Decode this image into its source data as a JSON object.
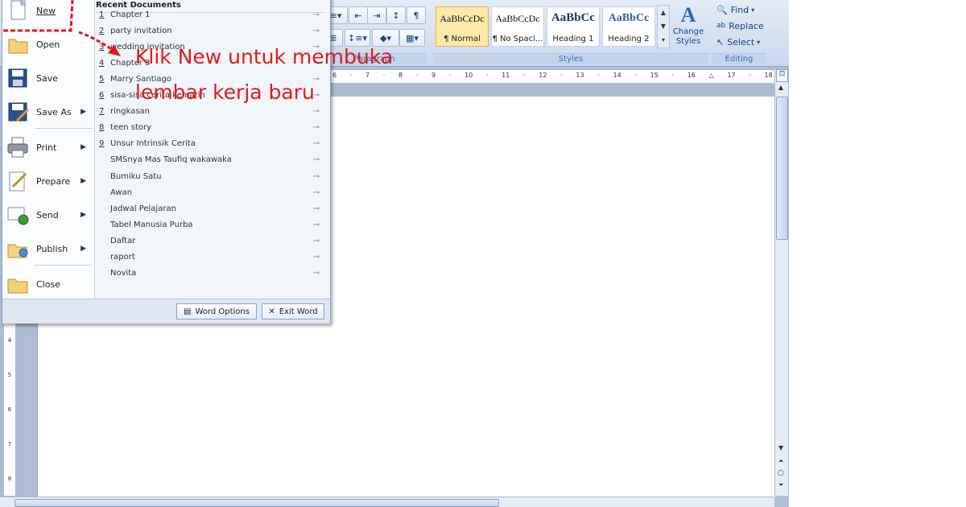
{
  "ribbon": {
    "paragraph_group": "Paragraph",
    "styles_group_label": "Styles",
    "editing_group_label": "Editing",
    "styles": [
      {
        "sample": "AaBbCcDc",
        "name": "¶ Normal"
      },
      {
        "sample": "AaBbCcDc",
        "name": "¶ No Spaci..."
      },
      {
        "sample": "AaBbCc",
        "name": "Heading 1"
      },
      {
        "sample": "AaBbCc",
        "name": "Heading 2"
      }
    ],
    "change_styles_label": "Change Styles",
    "editing": {
      "find": "Find",
      "replace": "Replace",
      "select": "Select"
    }
  },
  "ruler": {
    "marks": [
      "6",
      "7",
      "8",
      "9",
      "10",
      "11",
      "12",
      "13",
      "14",
      "15",
      "16",
      "17",
      "18"
    ],
    "vertical_marks": [
      "4",
      "5",
      "6",
      "7",
      "8"
    ]
  },
  "office_menu": {
    "items": [
      {
        "label": "New"
      },
      {
        "label": "Open"
      },
      {
        "label": "Save"
      },
      {
        "label": "Save As",
        "has_arrow": true
      },
      {
        "label": "Print",
        "has_arrow": true
      },
      {
        "label": "Prepare",
        "has_arrow": true
      },
      {
        "label": "Send",
        "has_arrow": true
      },
      {
        "label": "Publish",
        "has_arrow": true
      },
      {
        "label": "Close"
      }
    ],
    "recent_title": "Recent Documents",
    "recent": [
      {
        "num": "1",
        "name": "Chapter 1"
      },
      {
        "num": "2",
        "name": "party invitation"
      },
      {
        "num": "3",
        "name": "wedding invitation"
      },
      {
        "num": "4",
        "name": "Chapter 3"
      },
      {
        "num": "5",
        "name": "Marry Santiago"
      },
      {
        "num": "6",
        "name": "sisa-sisa cerita kemarin"
      },
      {
        "num": "7",
        "name": "ringkasan"
      },
      {
        "num": "8",
        "name": "teen story"
      },
      {
        "num": "9",
        "name": "Unsur Intrinsik Cerita"
      },
      {
        "num": "",
        "name": "SMSnya Mas Taufiq wakawaka"
      },
      {
        "num": "",
        "name": "Bumiku Satu"
      },
      {
        "num": "",
        "name": "Awan"
      },
      {
        "num": "",
        "name": "Jadwal Pelajaran"
      },
      {
        "num": "",
        "name": "Tabel Manusia Purba"
      },
      {
        "num": "",
        "name": "Daftar"
      },
      {
        "num": "",
        "name": "raport"
      },
      {
        "num": "",
        "name": "Novita"
      }
    ],
    "word_options": "Word Options",
    "exit_word": "Exit Word"
  },
  "annotation": {
    "line1": "Klik New untuk membuka",
    "line2": "lembar kerja baru",
    "color": "#e21a1a"
  },
  "colors": {
    "ribbon_bg": "#dbe6f4",
    "workspace": "#aebdd3",
    "accent": "#15428b"
  }
}
